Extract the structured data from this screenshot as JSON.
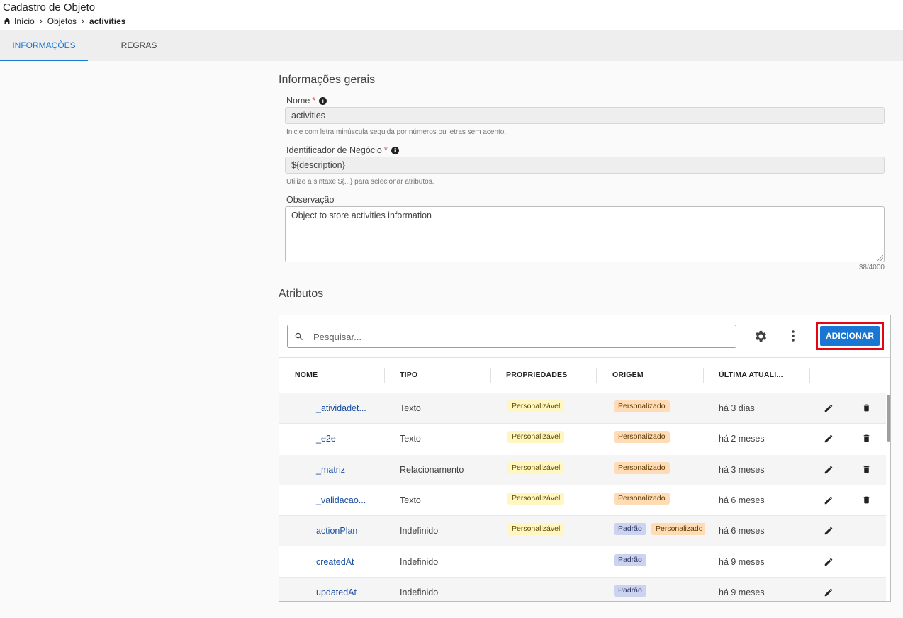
{
  "header": {
    "title": "Cadastro de Objeto",
    "breadcrumb": [
      "Início",
      "Objetos",
      "activities"
    ]
  },
  "tabs": [
    {
      "label": "INFORMAÇÕES",
      "active": true
    },
    {
      "label": "REGRAS",
      "active": false
    }
  ],
  "general": {
    "section_title": "Informações gerais",
    "name": {
      "label": "Nome",
      "required_mark": "*",
      "value": "activities",
      "hint": "Inicie com letra minúscula seguida por números ou letras sem acento."
    },
    "business_id": {
      "label": "Identificador de Negócio",
      "required_mark": "*",
      "value": "${description}",
      "hint": "Utilize a sintaxe ${...} para selecionar atributos."
    },
    "observation": {
      "label": "Observação",
      "value": "Object to store activities information",
      "counter": "38/4000"
    }
  },
  "attributes": {
    "section_title": "Atributos",
    "search_placeholder": "Pesquisar...",
    "add_label": "ADICIONAR",
    "columns": [
      "NOME",
      "TIPO",
      "PROPRIEDADES",
      "ORIGEM",
      "ÚLTIMA ATUALI..."
    ],
    "rows": [
      {
        "name": "_atividadet...",
        "type": "Texto",
        "properties": [
          "Personalizável"
        ],
        "origin": [
          "Personalizado"
        ],
        "updated": "há 3 dias",
        "deletable": true
      },
      {
        "name": "_e2e",
        "type": "Texto",
        "properties": [
          "Personalizável"
        ],
        "origin": [
          "Personalizado"
        ],
        "updated": "há 2 meses",
        "deletable": true
      },
      {
        "name": "_matriz",
        "type": "Relacionamento",
        "properties": [
          "Personalizável"
        ],
        "origin": [
          "Personalizado"
        ],
        "updated": "há 3 meses",
        "deletable": true
      },
      {
        "name": "_validacao...",
        "type": "Texto",
        "properties": [
          "Personalizável"
        ],
        "origin": [
          "Personalizado"
        ],
        "updated": "há 6 meses",
        "deletable": true
      },
      {
        "name": "actionPlan",
        "type": "Indefinido",
        "properties": [
          "Personalizável"
        ],
        "origin": [
          "Padrão",
          "Personalizado"
        ],
        "updated": "há 6 meses",
        "deletable": false
      },
      {
        "name": "createdAt",
        "type": "Indefinido",
        "properties": [],
        "origin": [
          "Padrão"
        ],
        "updated": "há 9 meses",
        "deletable": false
      },
      {
        "name": "updatedAt",
        "type": "Indefinido",
        "properties": [],
        "origin": [
          "Padrão"
        ],
        "updated": "há 9 meses",
        "deletable": false
      }
    ]
  },
  "colors": {
    "accent": "#1976d2",
    "highlight": "#e30613",
    "link": "#1a4fa0"
  }
}
